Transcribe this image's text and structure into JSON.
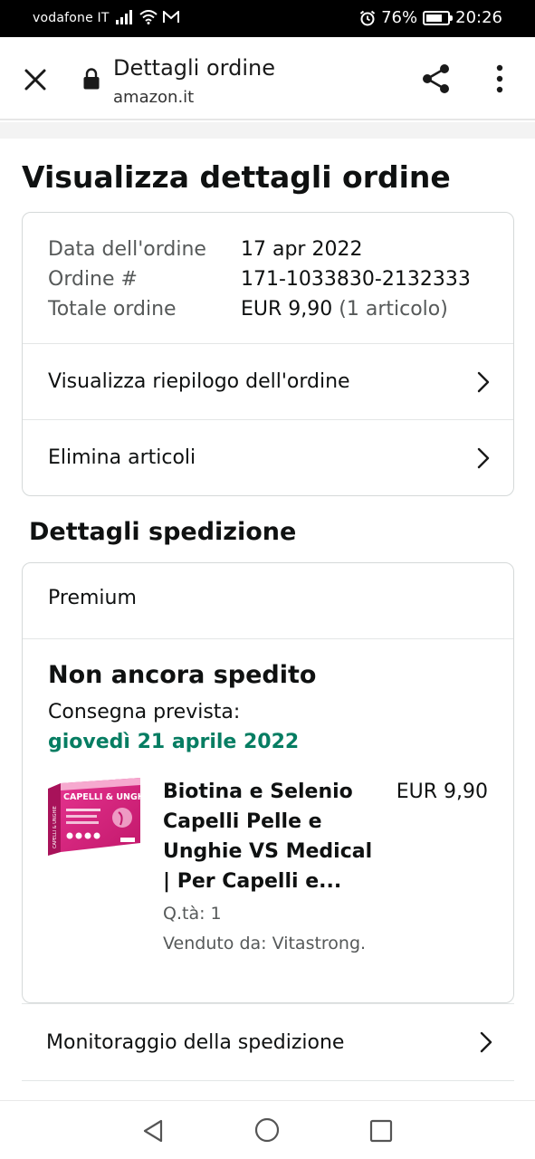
{
  "status_bar": {
    "carrier": "vodafone IT",
    "battery": "76%",
    "battery_level": 0.76,
    "time": "20:26"
  },
  "browser": {
    "title": "Dettagli ordine",
    "url": "amazon.it"
  },
  "page": {
    "title": "Visualizza dettagli ordine"
  },
  "order_summary": {
    "date_label": "Data dell'ordine",
    "date_value": "17 apr 2022",
    "number_label": "Ordine #",
    "number_value": "171-1033830-2132333",
    "total_label": "Totale ordine",
    "total_value": "EUR 9,90",
    "total_items": "(1 articolo)"
  },
  "order_actions": {
    "view_summary": "Visualizza riepilogo dell'ordine",
    "delete_items": "Elimina articoli"
  },
  "shipping": {
    "section_title": "Dettagli spedizione",
    "shipping_type": "Premium",
    "status": "Non ancora spedito",
    "delivery_label": "Consegna prevista:",
    "delivery_date": "giovedì 21 aprile 2022",
    "delivery_color": "#067d62",
    "product": {
      "title": "Biotina e Selenio Capelli Pelle e Unghie VS Medical | Per Capelli e...",
      "price": "EUR 9,90",
      "quantity": "Q.tà: 1",
      "seller": "Venduto da: Vitastrong.",
      "image_text": "CAPELLI & UNGHIE",
      "image_side_text": "CAPELLI & UNGHIE"
    },
    "tracking_label": "Monitoraggio della spedizione"
  },
  "icons": {
    "close": "close-icon",
    "lock": "lock-icon",
    "share": "share-icon",
    "more": "more-vert-icon",
    "chevron": "chevron-right-icon"
  }
}
